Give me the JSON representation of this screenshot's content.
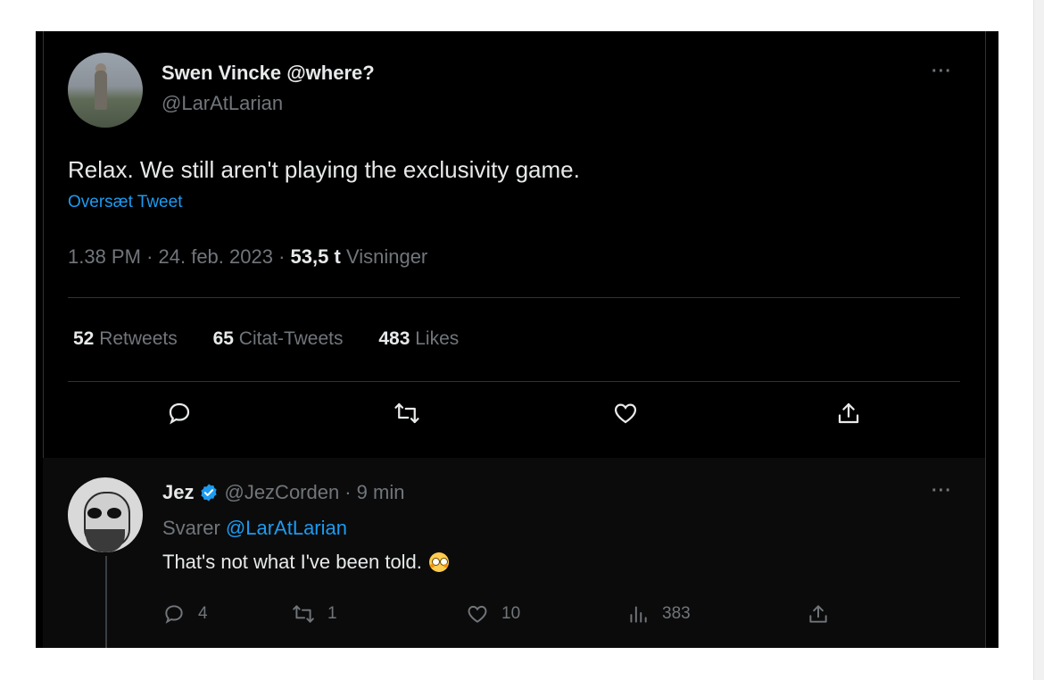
{
  "main_tweet": {
    "author_name": "Swen Vincke @where?",
    "author_handle": "@LarAtLarian",
    "more_label": "···",
    "text": "Relax. We still aren't playing the exclusivity game.",
    "translate_label": "Oversæt Tweet",
    "time": "1.38 PM",
    "date": "24. feb. 2023",
    "separator": "·",
    "views_count": "53,5 t",
    "views_label": "Visninger",
    "stats": [
      {
        "count": "52",
        "label": "Retweets"
      },
      {
        "count": "65",
        "label": "Citat-Tweets"
      },
      {
        "count": "483",
        "label": "Likes"
      }
    ],
    "actions": [
      "reply-icon",
      "retweet-icon",
      "like-icon",
      "share-icon"
    ]
  },
  "reply_tweet": {
    "author_name": "Jez",
    "author_handle": "@JezCorden",
    "time": "· 9 min",
    "more_label": "···",
    "replying_prefix": "Svarer",
    "replying_mention": "@LarAtLarian",
    "text": "That's not what I've been told.",
    "emoji": "flushed-face-emoji",
    "actions": [
      {
        "icon": "reply-icon",
        "count": "4"
      },
      {
        "icon": "retweet-icon",
        "count": "1"
      },
      {
        "icon": "like-icon",
        "count": "10"
      },
      {
        "icon": "views-icon",
        "count": "383"
      },
      {
        "icon": "share-icon",
        "count": ""
      }
    ]
  },
  "colors": {
    "background": "#000000",
    "text_primary": "#e7e9ea",
    "text_secondary": "#71767b",
    "accent": "#1d9bf0",
    "divider": "#2f3336"
  }
}
